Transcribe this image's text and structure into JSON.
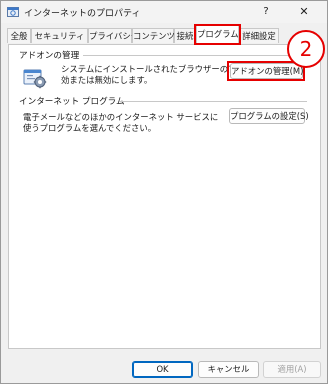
{
  "window": {
    "title": "インターネットのプロパティ",
    "help_glyph": "?",
    "close_glyph": "✕"
  },
  "tabs": [
    {
      "label": "全般",
      "selected": false
    },
    {
      "label": "セキュリティ",
      "selected": false
    },
    {
      "label": "プライバシー",
      "selected": false
    },
    {
      "label": "コンテンツ",
      "selected": false
    },
    {
      "label": "接続",
      "selected": false
    },
    {
      "label": "プログラム",
      "selected": true
    },
    {
      "label": "詳細設定",
      "selected": false
    }
  ],
  "addons": {
    "group_title": "アドオンの管理",
    "description_line1": "システムにインストールされたブラウザーのアドオンを有",
    "description_line2": "効または無効にします。",
    "manage_button": "アドオンの管理(M)",
    "icon": "addon-gear-icon"
  },
  "internet_programs": {
    "group_title": "インターネット プログラム",
    "description_line1": "電子メールなどのほかのインターネット サービスに",
    "description_line2": "使うプログラムを選んでください。",
    "set_button": "プログラムの設定(S)"
  },
  "annotation": {
    "step_number": "2",
    "color": "#e60000"
  },
  "footer": {
    "ok": "OK",
    "cancel": "キャンセル",
    "apply": "適用(A)"
  },
  "colors": {
    "accent": "#0067c0",
    "highlight": "#e60000"
  }
}
